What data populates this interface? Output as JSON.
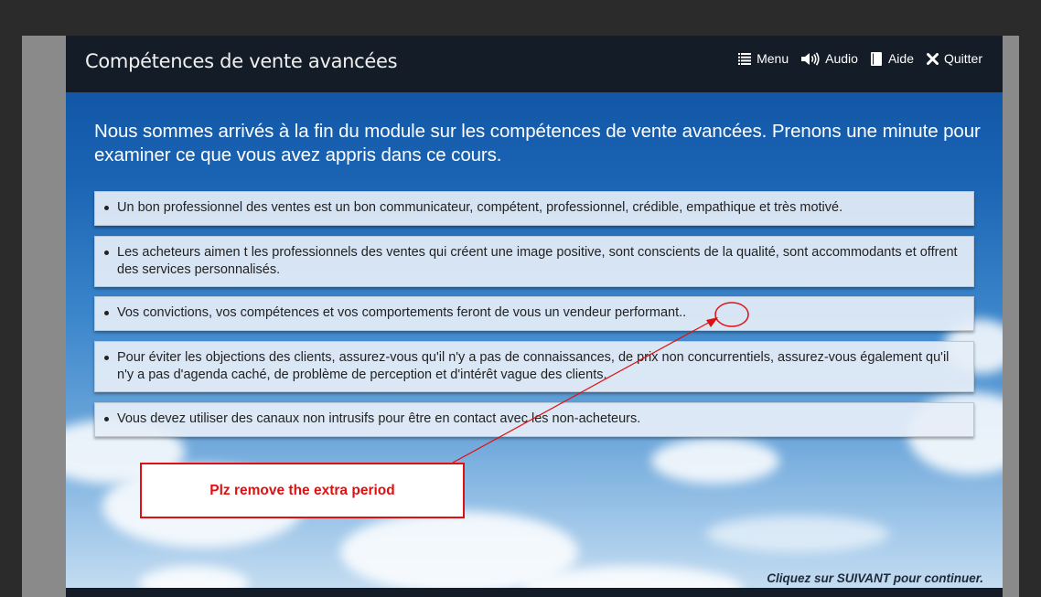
{
  "header": {
    "title": "Compétences de vente avancées",
    "nav": [
      {
        "label": "Menu",
        "icon": "menu-icon"
      },
      {
        "label": "Audio",
        "icon": "speaker-icon"
      },
      {
        "label": "Aide",
        "icon": "book-icon"
      },
      {
        "label": "Quitter",
        "icon": "close-icon"
      }
    ]
  },
  "content": {
    "heading": "Nous sommes arrivés à la fin du module sur les compétences de vente avancées. Prenons une minute pour examiner ce que vous avez appris dans ce cours.",
    "bullets": [
      "Un bon professionnel des ventes est un bon communicateur, compétent, professionnel, crédible, empathique et très motivé.",
      "Les acheteurs aimen t les professionnels des ventes qui créent une image positive, sont conscients de la qualité, sont accommodants et offrent des services personnalisés.",
      "Vos convictions, vos compétences et vos comportements feront de vous un vendeur performant..",
      "Pour éviter les objections des clients, assurez-vous qu'il n'y a pas de connaissances, de prix non concurrentiels, assurez-vous également qu'il n'y a pas d'agenda caché, de problème de perception et d'intérêt vague des clients.",
      "Vous devez utiliser des canaux non intrusifs pour être en contact avec les non-acheteurs."
    ],
    "next_hint": "Cliquez sur SUIVANT pour continuer."
  },
  "annotation": {
    "text": "Plz remove the extra period",
    "color": "#e01010"
  },
  "colors": {
    "header_bg": "#141c27",
    "sky_top": "#0d4f9e",
    "card_bg": "#e6eef7"
  }
}
